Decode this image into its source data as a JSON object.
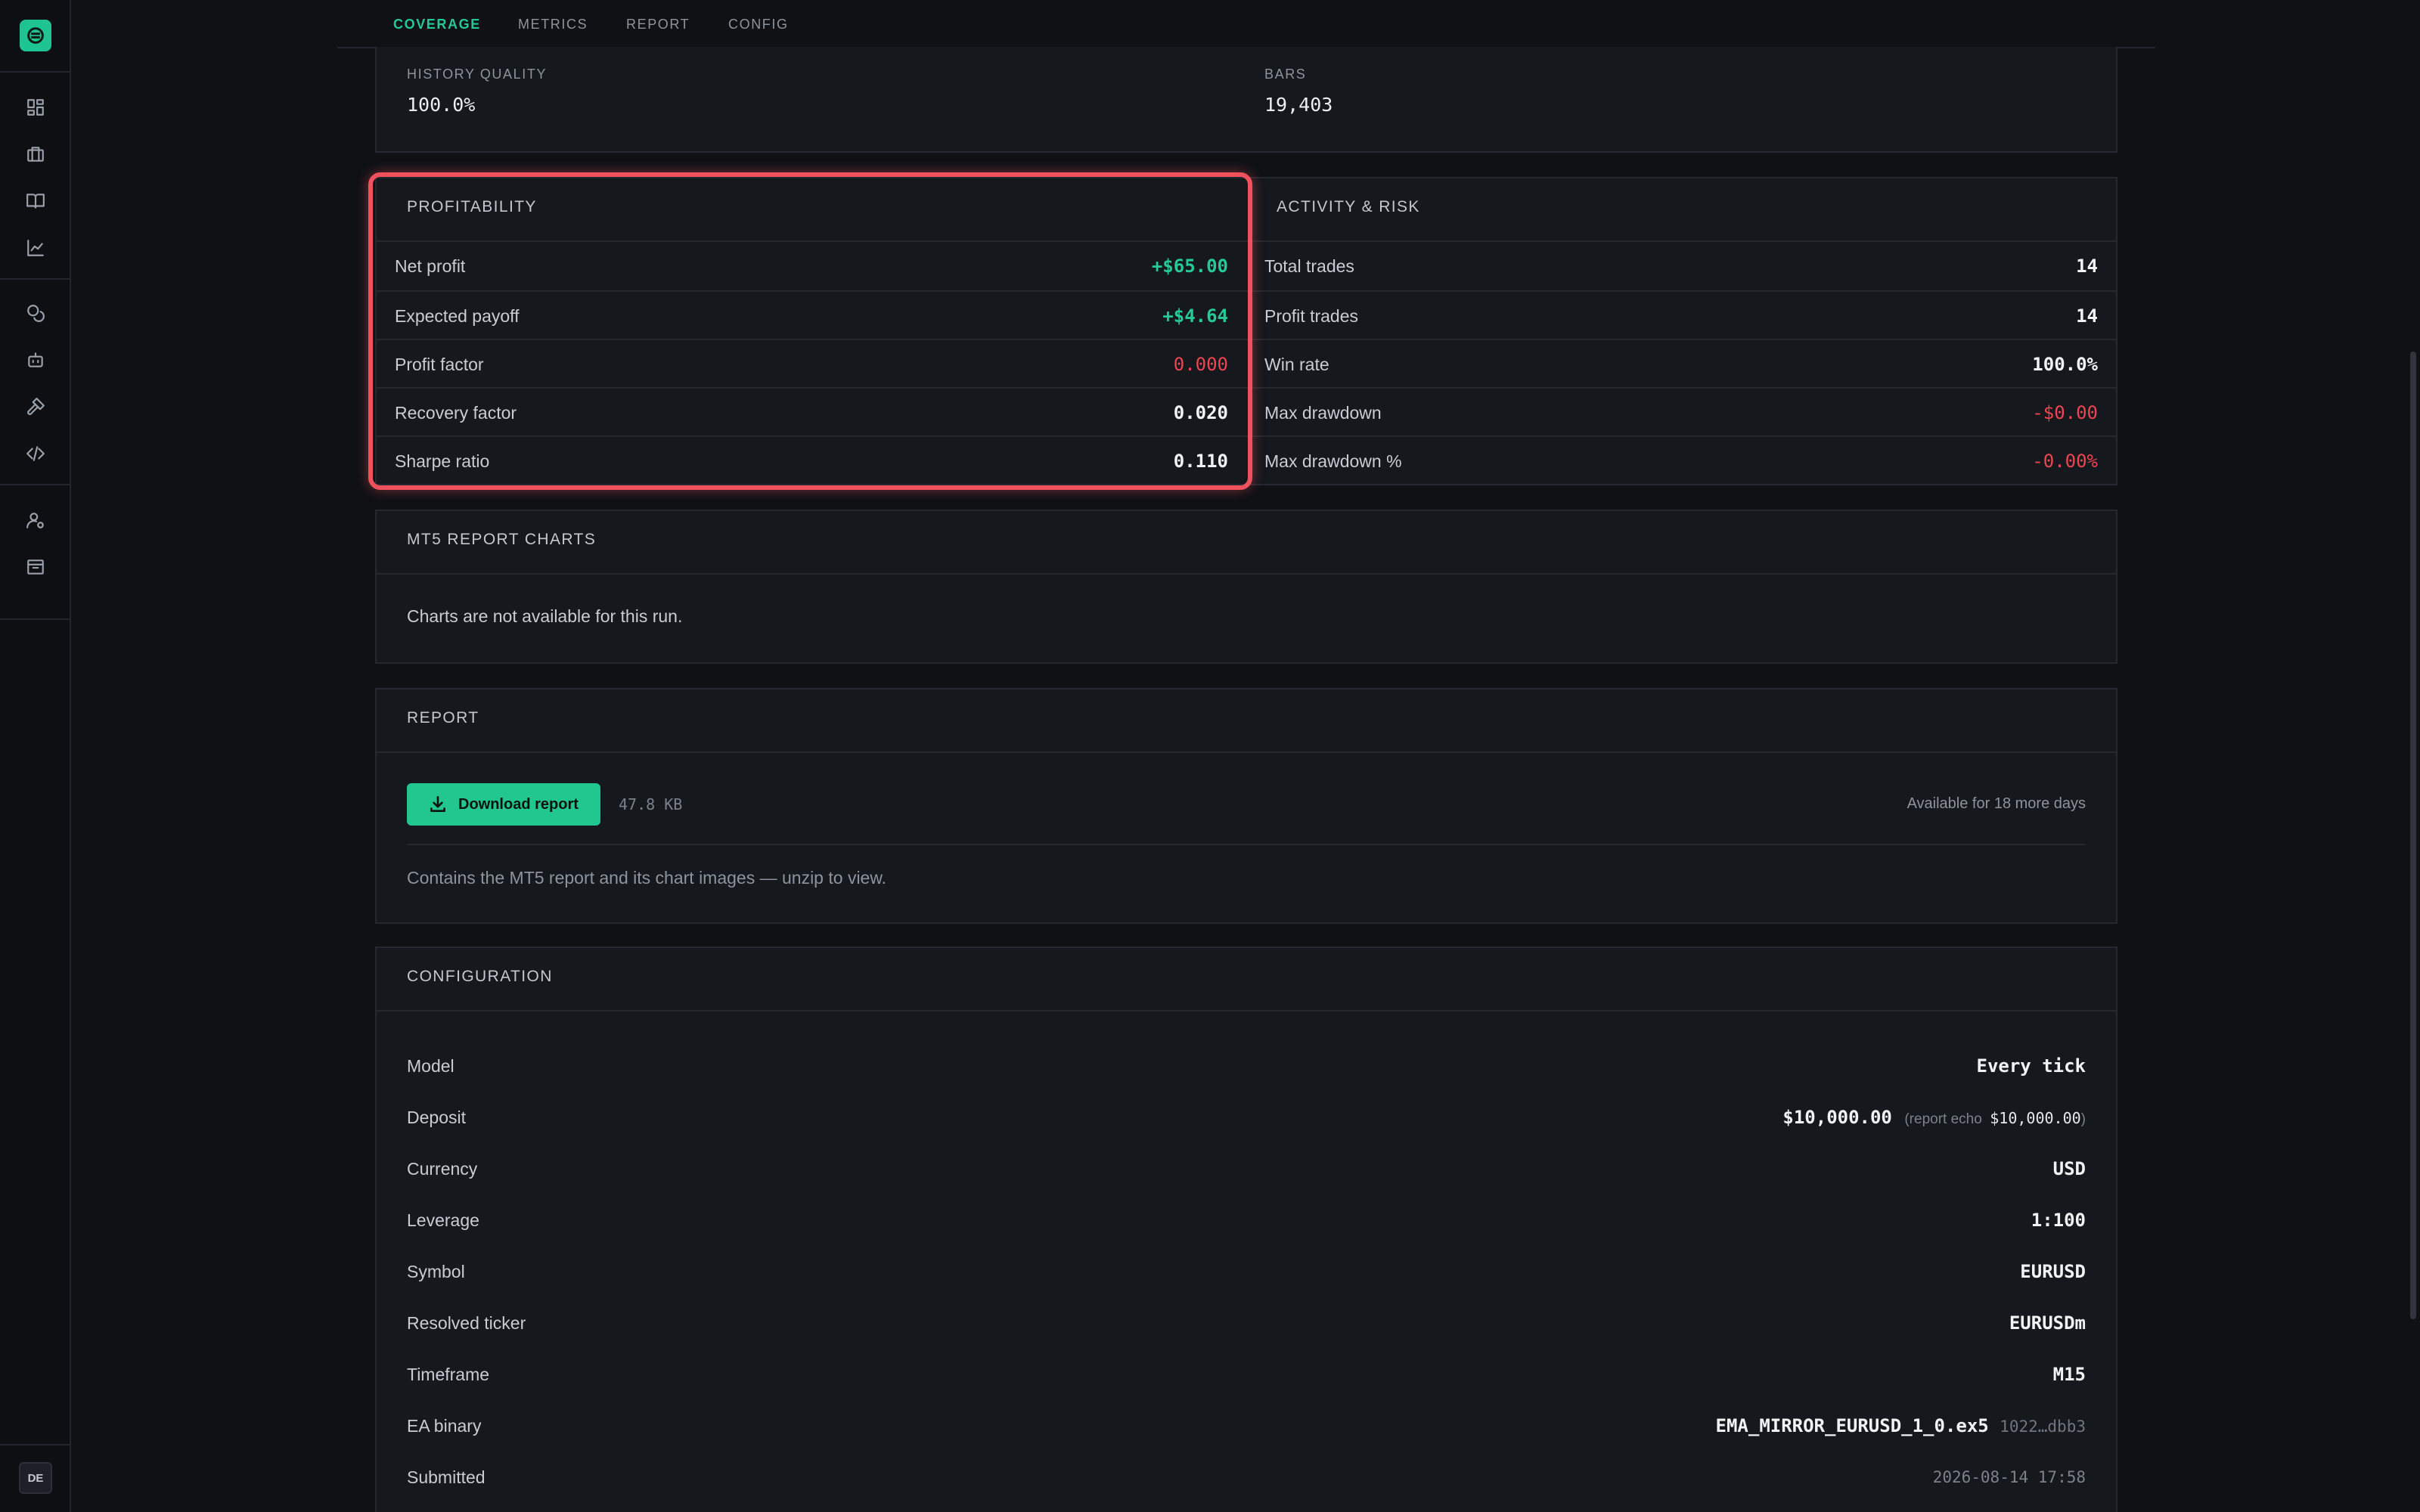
{
  "sidebar": {
    "logo_icon": "logo-icon",
    "icons": [
      "dashboard-icon",
      "briefcase-icon",
      "book-icon",
      "chart-line-icon",
      "coins-icon",
      "robot-icon",
      "hammer-icon",
      "code-icon",
      "user-gear-icon",
      "archive-icon"
    ],
    "lang": "DE"
  },
  "tabs": [
    {
      "label": "COVERAGE",
      "active": true
    },
    {
      "label": "METRICS",
      "active": false
    },
    {
      "label": "REPORT",
      "active": false
    },
    {
      "label": "CONFIG",
      "active": false
    }
  ],
  "coverage": {
    "history_quality_label": "HISTORY QUALITY",
    "history_quality_value": "100.0%",
    "bars_label": "BARS",
    "bars_value": "19,403"
  },
  "profitability": {
    "title": "PROFITABILITY",
    "rows": [
      {
        "label": "Net profit",
        "value": "+$65.00",
        "tone": "positive"
      },
      {
        "label": "Expected payoff",
        "value": "+$4.64",
        "tone": "positive"
      },
      {
        "label": "Profit factor",
        "value": "0.000",
        "tone": "negative"
      },
      {
        "label": "Recovery factor",
        "value": "0.020",
        "tone": "neutral"
      },
      {
        "label": "Sharpe ratio",
        "value": "0.110",
        "tone": "neutral"
      }
    ]
  },
  "activity": {
    "title": "ACTIVITY & RISK",
    "rows": [
      {
        "label": "Total trades",
        "value": "14",
        "tone": "neutral"
      },
      {
        "label": "Profit trades",
        "value": "14",
        "tone": "neutral"
      },
      {
        "label": "Win rate",
        "value": "100.0%",
        "tone": "neutral"
      },
      {
        "label": "Max drawdown",
        "value": "-$0.00",
        "tone": "negative"
      },
      {
        "label": "Max drawdown %",
        "value": "-0.00%",
        "tone": "negative"
      }
    ]
  },
  "charts": {
    "title": "MT5 REPORT CHARTS",
    "message": "Charts are not available for this run."
  },
  "report": {
    "title": "REPORT",
    "download_label": "Download report",
    "size": "47.8 KB",
    "availability": "Available for 18 more days",
    "note": "Contains the MT5 report and its chart images — unzip to view."
  },
  "configuration": {
    "title": "CONFIGURATION",
    "model_label": "Model",
    "model_value": "Every tick",
    "deposit_label": "Deposit",
    "deposit_value": "$10,000.00",
    "deposit_echo_prefix": "(report echo",
    "deposit_echo_value": "$10,000.00",
    "deposit_echo_suffix": ")",
    "currency_label": "Currency",
    "currency_value": "USD",
    "leverage_label": "Leverage",
    "leverage_value": "1:100",
    "symbol_label": "Symbol",
    "symbol_value": "EURUSD",
    "ticker_label": "Resolved ticker",
    "ticker_value": "EURUSDm",
    "timeframe_label": "Timeframe",
    "timeframe_value": "M15",
    "binary_label": "EA binary",
    "binary_value": "EMA_MIRROR_EURUSD_1_0.ex5",
    "binary_hash": "1022…dbb3",
    "submitted_label": "Submitted",
    "submitted_value": "2026-08-14 17:58"
  },
  "colors": {
    "accent": "#22c997",
    "negative": "#ef4453",
    "highlight": "#f0515c",
    "background": "#0f1115",
    "card": "#15181d"
  }
}
